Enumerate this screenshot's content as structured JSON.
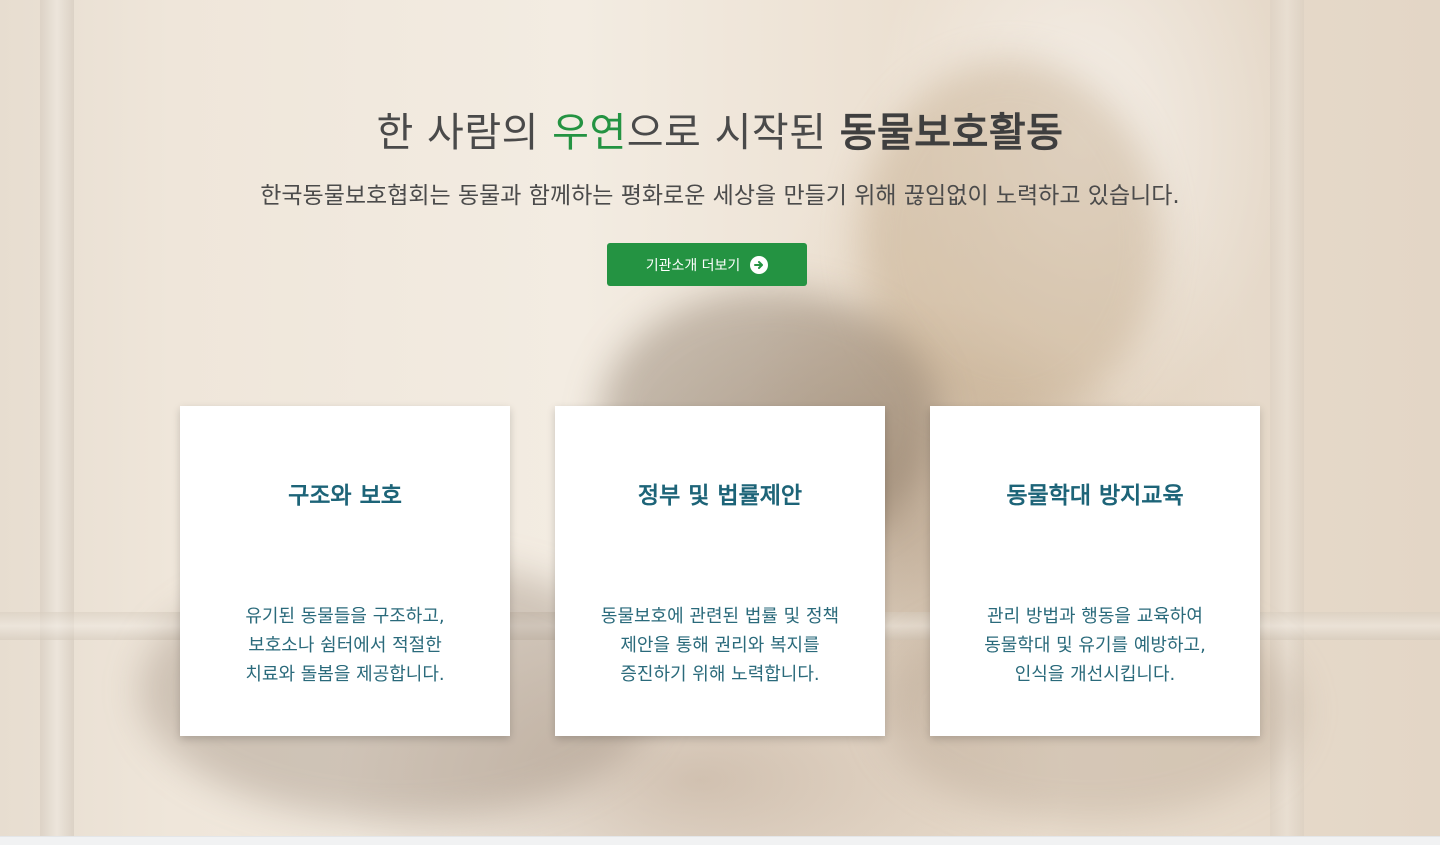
{
  "hero": {
    "headline_part1": "한 사람의 ",
    "headline_accent": "우연",
    "headline_part2": "으로 시작된 ",
    "headline_bold": "동물보호활동",
    "subline": "한국동물보호협회는 동물과 함께하는 평화로운 세상을 만들기 위해 끊임없이 노력하고 있습니다.",
    "cta_label": "기관소개 더보기",
    "cta_icon": "arrow-right-circle-icon",
    "accent_color": "#249342"
  },
  "cards": [
    {
      "title": "구조와 보호",
      "lines": [
        "유기된 동물들을 구조하고,",
        "보호소나 쉼터에서 적절한",
        "치료와 돌봄을 제공합니다."
      ]
    },
    {
      "title": "정부 및 법률제안",
      "lines": [
        "동물보호에 관련된 법률 및 정책",
        "제안을 통해 권리와 복지를",
        "증진하기 위해 노력합니다."
      ]
    },
    {
      "title": "동물학대 방지교육",
      "lines": [
        "관리 방법과 행동을 교육하여",
        "동물학대 및 유기를 예방하고,",
        "인식을 개선시킵니다."
      ]
    }
  ],
  "colors": {
    "card_title": "#1d6478",
    "card_text": "#2a6a7b",
    "button": "#249342"
  }
}
